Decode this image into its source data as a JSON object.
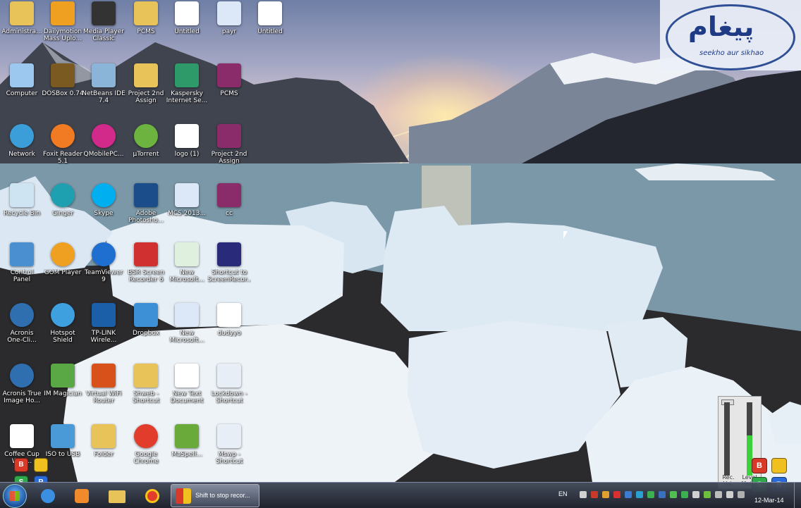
{
  "desktop": {
    "icons": [
      {
        "label": "Administra...",
        "icon": "user-folder-icon",
        "color": "#e8c35a"
      },
      {
        "label": "Dailymotion\nMass Uplo...",
        "icon": "dailymotion-icon",
        "color": "#f0a020"
      },
      {
        "label": "Media Player\nClassic",
        "icon": "media-player-classic-icon",
        "color": "#333333"
      },
      {
        "label": "PCMS",
        "icon": "folder-icon",
        "color": "#e8c35a"
      },
      {
        "label": "Untitled",
        "icon": "image-file-icon",
        "color": "#ffffff"
      },
      {
        "label": "payr",
        "icon": "word-doc-icon",
        "color": "#dce7f7"
      },
      {
        "label": "Untitled",
        "icon": "pdf-file-icon",
        "color": "#ffffff"
      },
      {
        "label": "Computer",
        "icon": "computer-icon",
        "color": "#9cc7ee"
      },
      {
        "label": "DOSBox 0.74",
        "icon": "dosbox-icon",
        "color": "#7a5a20"
      },
      {
        "label": "NetBeans IDE\n7.4",
        "icon": "netbeans-icon",
        "color": "#8ab4d8"
      },
      {
        "label": "Project 2nd\nAssign",
        "icon": "folder-icon",
        "color": "#e8c35a"
      },
      {
        "label": "Kaspersky\nInternet Se...",
        "icon": "kaspersky-icon",
        "color": "#2e9a6a"
      },
      {
        "label": "PCMS",
        "icon": "winrar-icon",
        "color": "#8a2b6a"
      },
      {
        "label": "Network",
        "icon": "network-icon",
        "color": "#3b9ed8"
      },
      {
        "label": "Foxit Reader\n5.1",
        "icon": "foxit-reader-icon",
        "color": "#f07b22"
      },
      {
        "label": "QMobilePC...",
        "icon": "qmobile-icon",
        "color": "#d22a8a"
      },
      {
        "label": "µTorrent",
        "icon": "utorrent-icon",
        "color": "#6cb33f"
      },
      {
        "label": "logo (1)",
        "icon": "image-file-icon",
        "color": "#ffffff"
      },
      {
        "label": "Project 2nd\nAssign",
        "icon": "winrar-icon",
        "color": "#8a2b6a"
      },
      {
        "label": "Recycle Bin",
        "icon": "recycle-bin-icon",
        "color": "#cfe4f3"
      },
      {
        "label": "Ginger",
        "icon": "ginger-icon",
        "color": "#1fa0b0"
      },
      {
        "label": "Skype",
        "icon": "skype-icon",
        "color": "#00aff0"
      },
      {
        "label": "Adobe\nPhotosho...",
        "icon": "photoshop-icon",
        "color": "#1b4d8a"
      },
      {
        "label": "MCS 2013...",
        "icon": "word-doc-icon",
        "color": "#dce7f7"
      },
      {
        "label": "cc",
        "icon": "winrar-icon",
        "color": "#8a2b6a"
      },
      {
        "label": "Control\nPanel",
        "icon": "control-panel-icon",
        "color": "#4a90d0"
      },
      {
        "label": "GOM Player",
        "icon": "gom-player-icon",
        "color": "#f0a020"
      },
      {
        "label": "TeamViewer\n9",
        "icon": "teamviewer-icon",
        "color": "#1f6fd0"
      },
      {
        "label": "BSR Screen\nRecorder 6",
        "icon": "bsr-recorder-icon",
        "color": "#d03030"
      },
      {
        "label": "New\nMicrosoft...",
        "icon": "excel-doc-icon",
        "color": "#dff0df"
      },
      {
        "label": "Shortcut to\nScreenRecor...",
        "icon": "lightning-icon",
        "color": "#2a2a7a"
      },
      {
        "label": "Acronis\nOne-Cli...",
        "icon": "acronis-icon",
        "color": "#2f6fb0"
      },
      {
        "label": "Hotspot\nShield",
        "icon": "hotspot-shield-icon",
        "color": "#3fa0e0"
      },
      {
        "label": "TP-LINK\nWirele...",
        "icon": "tplink-icon",
        "color": "#1a5fa8"
      },
      {
        "label": "Dropbox",
        "icon": "dropbox-icon",
        "color": "#3d8fd6"
      },
      {
        "label": "New\nMicrosoft...",
        "icon": "word-doc-icon",
        "color": "#dce7f7"
      },
      {
        "label": "dudyyo",
        "icon": "image-file-icon",
        "color": "#ffffff"
      },
      {
        "label": "Acronis True\nImage Ho...",
        "icon": "acronis-true-image-icon",
        "color": "#2f6fb0"
      },
      {
        "label": "IM Magician",
        "icon": "im-magician-icon",
        "color": "#5aa845"
      },
      {
        "label": "Virtual WiFi\nRouter",
        "icon": "virtual-router-icon",
        "color": "#d8501a"
      },
      {
        "label": "Shweb -\nShortcut",
        "icon": "folder-shortcut-icon",
        "color": "#e8c35a"
      },
      {
        "label": "New Text\nDocument",
        "icon": "text-doc-icon",
        "color": "#ffffff"
      },
      {
        "label": "Lockdown -\nShortcut",
        "icon": "settings-shortcut-icon",
        "color": "#e8eef5"
      },
      {
        "label": "Coffee Cup\nWeb...",
        "icon": "coffeecup-icon",
        "color": "#ffffff"
      },
      {
        "label": "ISO to USB",
        "icon": "iso-to-usb-icon",
        "color": "#4a9ad8"
      },
      {
        "label": "Folder",
        "icon": "folder-icon",
        "color": "#e8c35a"
      },
      {
        "label": "Google\nChrome",
        "icon": "chrome-icon",
        "color": "#e23c2c"
      },
      {
        "label": "MaSpell...",
        "icon": "notepad-icon",
        "color": "#6aaa3a"
      },
      {
        "label": "Mswp -\nShortcut",
        "icon": "settings-shortcut-icon",
        "color": "#e8eef5"
      }
    ]
  },
  "watermark": {
    "title": "پیغام",
    "subtitle": "seekho aur sikhao"
  },
  "recorder": {
    "labels": [
      "Rec.\nVol.",
      "Level\nMeter"
    ],
    "level": 0.55,
    "brand_letters": [
      "B",
      "S",
      "R"
    ],
    "brand_colors": [
      "#d83a2a",
      "#f0c020",
      "#2fa84a",
      "#2a6ad8"
    ]
  },
  "taskbar": {
    "start_icon": "windows-start-icon",
    "pinned": [
      {
        "name": "internet-explorer-icon",
        "color": "#3a8fe0"
      },
      {
        "name": "media-player-icon",
        "color": "#f08a2a"
      },
      {
        "name": "explorer-folder-icon",
        "color": "#e8c35a"
      },
      {
        "name": "chrome-icon",
        "color": "#e23c2c"
      }
    ],
    "active_task_label": "Shift to stop recor...",
    "lang": "EN",
    "date": "12-Mar-14"
  },
  "colors": {
    "accent": "#1f3b85"
  }
}
